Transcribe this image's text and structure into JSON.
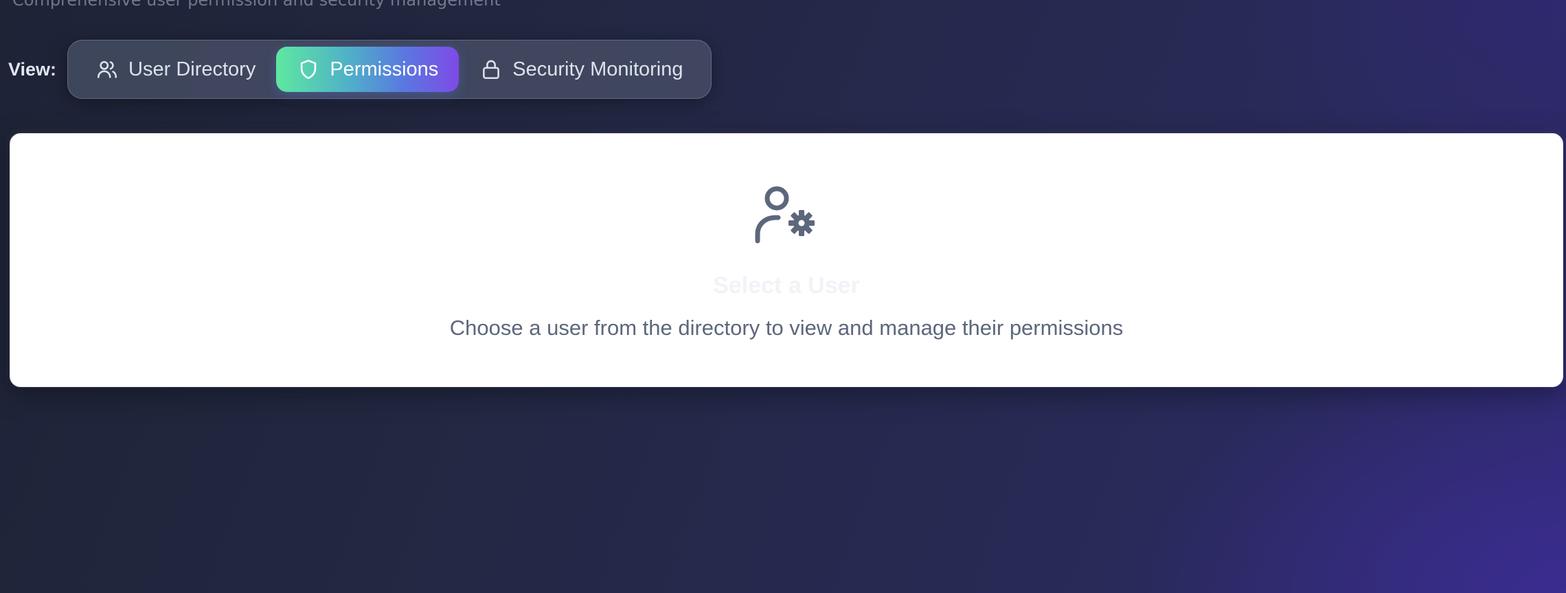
{
  "header": {
    "subtitle_fragment": "Comprehensive user permission and security management"
  },
  "view_switcher": {
    "label": "View:",
    "tabs": [
      {
        "label": "User Directory",
        "icon": "users-icon",
        "active": false
      },
      {
        "label": "Permissions",
        "icon": "shield-icon",
        "active": true
      },
      {
        "label": "Security Monitoring",
        "icon": "lock-icon",
        "active": false
      }
    ]
  },
  "empty_state": {
    "icon": "user-cog-icon",
    "title": "Select a User",
    "description": "Choose a user from the directory to view and manage their permissions"
  },
  "colors": {
    "active_gradient_start": "#5ee8a0",
    "active_gradient_end": "#7e4ae6",
    "icon_gray": "#5d677c"
  }
}
